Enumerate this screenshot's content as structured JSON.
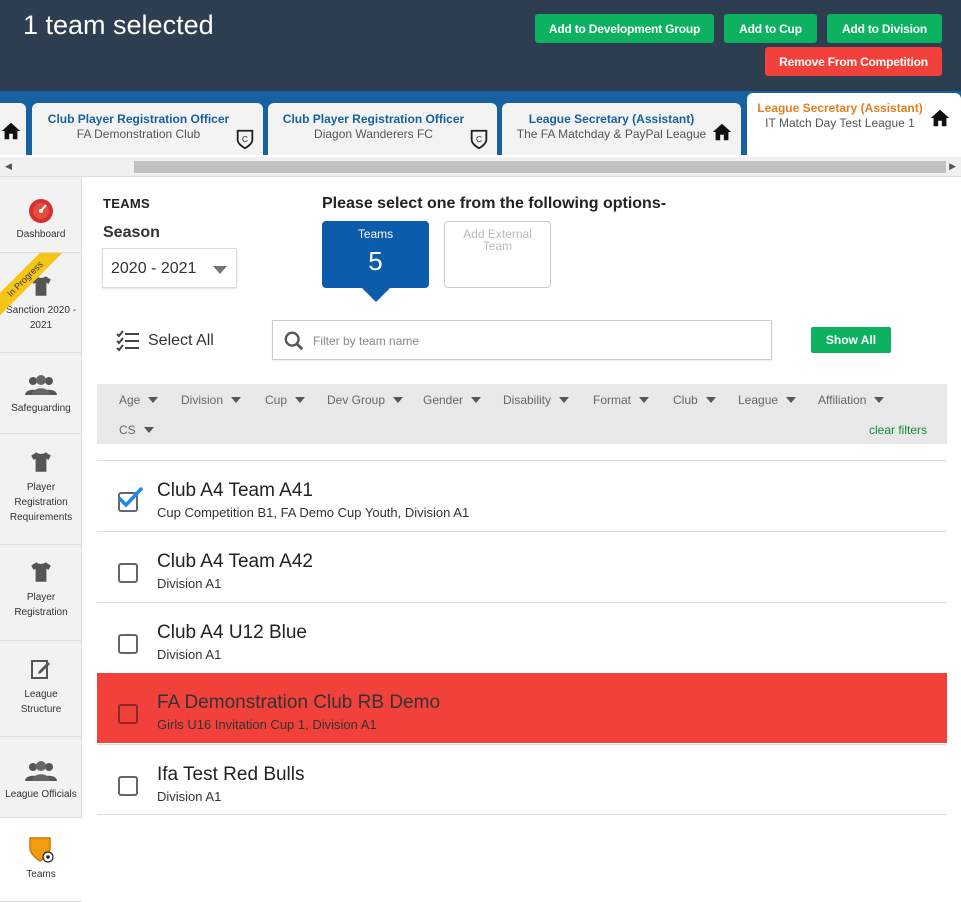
{
  "header": {
    "title": "1 team selected",
    "buttons": {
      "add_dev_group": "Add to Development Group",
      "add_cup": "Add to Cup",
      "add_division": "Add to Division",
      "remove_competition": "Remove From Competition"
    }
  },
  "role_tabs": [
    {
      "role": "Club Player Registration Officer",
      "org": "FA Demonstration Club",
      "icon": "club-crest-icon"
    },
    {
      "role": "Club Player Registration Officer",
      "org": "Diagon Wanderers FC",
      "icon": "club-crest-icon"
    },
    {
      "role": "League Secretary (Assistant)",
      "org": "The FA Matchday & PayPal League",
      "icon": "home-icon"
    },
    {
      "role": "League Secretary (Assistant)",
      "org": "IT Match Day Test League 1",
      "icon": "home-icon",
      "active": true
    }
  ],
  "sidebar": {
    "items": [
      {
        "label": "Dashboard",
        "icon": "speedometer-icon"
      },
      {
        "label": "Sanction 2020 - 2021",
        "icon": "shirt-icon",
        "ribbon": "In Progress"
      },
      {
        "label": "Safeguarding",
        "icon": "people-icon"
      },
      {
        "label": "Player Registration Requirements",
        "icon": "shirt-icon"
      },
      {
        "label": "Player Registration",
        "icon": "shirt-icon"
      },
      {
        "label": "League Structure",
        "icon": "edit-icon"
      },
      {
        "label": "League Officials",
        "icon": "people-icon"
      },
      {
        "label": "Teams",
        "icon": "shield-ball-icon",
        "active": true
      }
    ]
  },
  "main": {
    "section_title": "TEAMS",
    "season_label": "Season",
    "season_value": "2020 - 2021",
    "options_heading": "Please select one from the following options-",
    "options": {
      "teams_label": "Teams",
      "teams_count": "5",
      "external_label": "Add External Team"
    },
    "select_all": "Select All",
    "filter_placeholder": "Filter by team name",
    "show_all": "Show All",
    "filters": [
      "Age",
      "Division",
      "Cup",
      "Dev Group",
      "Gender",
      "Disability",
      "Format",
      "Club",
      "League",
      "Affiliation",
      "CS"
    ],
    "clear_filters": "clear filters",
    "teams": [
      {
        "name": "Club A4 Team A41",
        "detail": "Cup Competition B1, FA Demo Cup Youth, Division A1",
        "checked": true,
        "highlight": false
      },
      {
        "name": "Club A4 Team A42",
        "detail": "Division A1",
        "checked": false,
        "highlight": false
      },
      {
        "name": "Club A4 U12 Blue",
        "detail": "Division A1",
        "checked": false,
        "highlight": false
      },
      {
        "name": "FA Demonstration Club RB Demo",
        "detail": "Girls U16 Invitation Cup 1, Division A1",
        "checked": false,
        "highlight": true
      },
      {
        "name": "Ifa Test Red Bulls",
        "detail": "Division A1",
        "checked": false,
        "highlight": false
      }
    ]
  },
  "colors": {
    "header_bg": "#2c3e50",
    "tab_bar_bg": "#1761a0",
    "green": "#0db261",
    "red": "#f2413a",
    "blue_option": "#0b5cad",
    "active_tab_text": "#e67e22"
  }
}
